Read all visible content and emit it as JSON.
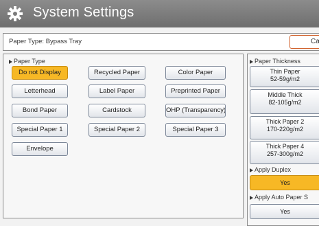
{
  "header": {
    "title": "System Settings"
  },
  "paper_type_row": {
    "label": "Paper Type: Bypass Tray",
    "cancel_label": "Canc"
  },
  "paper_type": {
    "label": "Paper Type",
    "buttons": [
      "Do not Display",
      "Recycled Paper",
      "Color Paper",
      "Letterhead",
      "Label Paper",
      "Preprinted Paper",
      "Bond Paper",
      "Cardstock",
      "OHP (Transparency)",
      "Special Paper 1",
      "Special Paper 2",
      "Special Paper 3",
      "Envelope"
    ],
    "selected": "Do not Display"
  },
  "paper_thickness": {
    "label": "Paper Thickness",
    "options": [
      {
        "name": "Thin Paper",
        "range": "52-59g/m2"
      },
      {
        "name": "Middle Thick",
        "range": "82-105g/m2"
      },
      {
        "name": "Thick Paper 2",
        "range": "170-220g/m2"
      },
      {
        "name": "Thick Paper 4",
        "range": "257-300g/m2"
      }
    ]
  },
  "apply_duplex": {
    "label": "Apply Duplex",
    "value": "Yes"
  },
  "apply_auto_paper": {
    "label": "Apply Auto Paper S",
    "value": "Yes"
  },
  "colors": {
    "selected": "#f7b825",
    "cancel_border": "#d0602a",
    "titlebar": "#7a7a7a"
  }
}
